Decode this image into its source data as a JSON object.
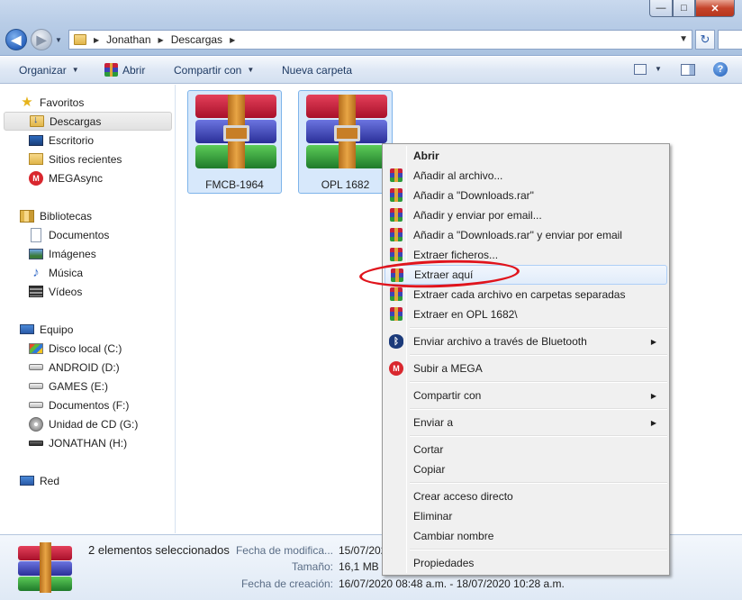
{
  "window": {
    "controls": {
      "minimize": "—",
      "maximize": "□",
      "close": "✕"
    }
  },
  "address": {
    "segments": [
      "Jonathan",
      "Descargas"
    ]
  },
  "commands": {
    "organize": "Organizar",
    "open": "Abrir",
    "share": "Compartir con",
    "new_folder": "Nueva carpeta",
    "help": "?"
  },
  "nav": {
    "favorites": "Favoritos",
    "favorites_items": [
      "Descargas",
      "Escritorio",
      "Sitios recientes",
      "MEGAsync"
    ],
    "libraries": "Bibliotecas",
    "libraries_items": [
      "Documentos",
      "Imágenes",
      "Música",
      "Vídeos"
    ],
    "computer": "Equipo",
    "computer_items": [
      "Disco local (C:)",
      "ANDROID (D:)",
      "GAMES (E:)",
      "Documentos (F:)",
      "Unidad de CD (G:)",
      "JONATHAN (H:)"
    ],
    "network": "Red"
  },
  "files": [
    {
      "name": "FMCB-1964"
    },
    {
      "name": "OPL 1682"
    }
  ],
  "details": {
    "selection": "2 elementos seleccionados",
    "modified_label": "Fecha de modifica...",
    "modified_value": "15/07/2020",
    "size_label": "Tamaño:",
    "size_value": "16,1 MB",
    "created_label": "Fecha de creación:",
    "created_value": "16/07/2020 08:48 a.m. - 18/07/2020 10:28 a.m."
  },
  "context_menu": {
    "items": [
      "Abrir",
      "Añadir al archivo...",
      "Añadir a \"Downloads.rar\"",
      "Añadir y enviar por email...",
      "Añadir a \"Downloads.rar\" y enviar por email",
      "Extraer ficheros...",
      "Extraer aquí",
      "Extraer cada archivo en carpetas separadas",
      "Extraer en OPL 1682\\",
      "Enviar archivo a través de Bluetooth",
      "Subir a MEGA",
      "Compartir con",
      "Enviar a",
      "Cortar",
      "Copiar",
      "Crear acceso directo",
      "Eliminar",
      "Cambiar nombre",
      "Propiedades"
    ],
    "highlighted": "Extraer aquí"
  },
  "colors": {
    "annotation": "#e0141c",
    "selection_fill": "#d7e8fb",
    "selection_border": "#7eb4ea"
  }
}
